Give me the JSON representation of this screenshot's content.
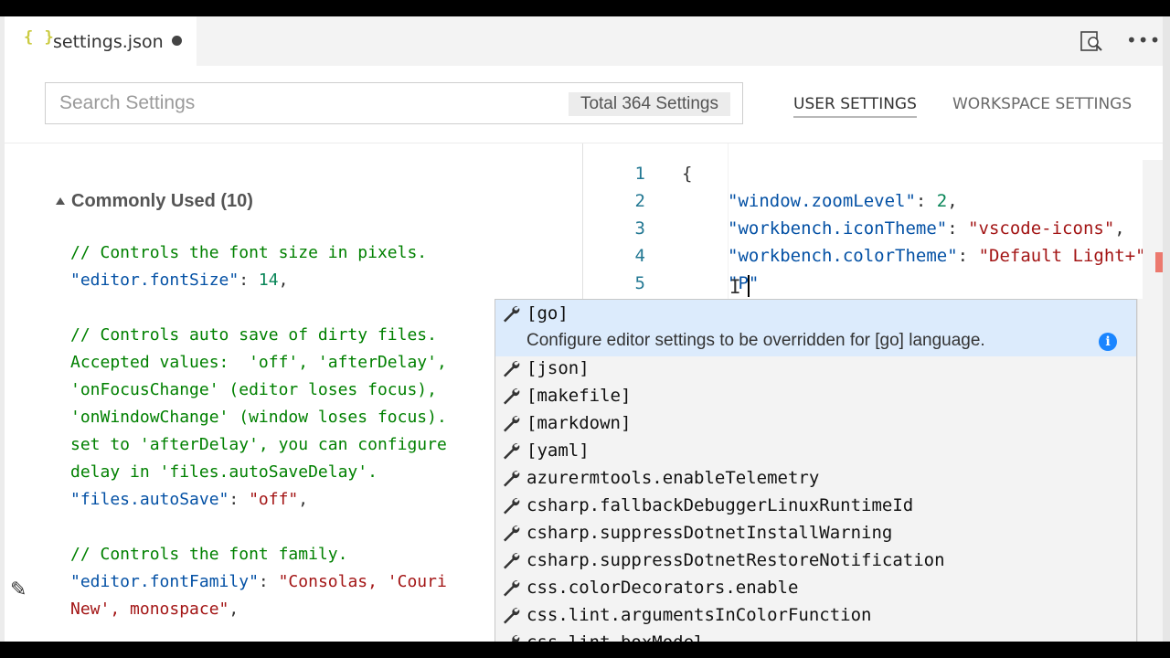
{
  "tab": {
    "icon": "{ }",
    "title": "settings.json"
  },
  "header": {
    "search_placeholder": "Search Settings",
    "count_badge": "Total 364 Settings",
    "tabs": [
      "USER SETTINGS",
      "WORKSPACE SETTINGS"
    ]
  },
  "default_pane": {
    "group_title": "Commonly Used (10)",
    "lines": [
      "// Controls the font size in pixels.",
      "\"editor.fontSize\"",
      ": ",
      "14",
      ",",
      "// Controls auto save of dirty files.",
      "Accepted values:  'off', 'afterDelay',",
      "'onFocusChange' (editor loses focus),",
      "'onWindowChange' (window loses focus).",
      "set to 'afterDelay', you can configure",
      "delay in 'files.autoSaveDelay'.",
      "\"files.autoSave\"",
      ": ",
      "\"off\"",
      ",",
      "// Controls the font family.",
      "\"editor.fontFamily\"",
      ": ",
      "\"Consolas, 'Couri",
      "New', monospace\"",
      ","
    ]
  },
  "editor": {
    "line_numbers": [
      "1",
      "2",
      "3",
      "4",
      "5"
    ],
    "code": {
      "l1": "{",
      "l2_key": "\"window.zoomLevel\"",
      "l2_colon": ": ",
      "l2_val": "2",
      "l2_end": ",",
      "l3_key": "\"workbench.iconTheme\"",
      "l3_colon": ": ",
      "l3_val": "\"vscode-icons\"",
      "l3_end": ",",
      "l4_key": "\"workbench.colorTheme\"",
      "l4_colon": ": ",
      "l4_val": "\"Default Light+\"",
      "l5_val": "\"P\""
    }
  },
  "suggest": {
    "selected_detail": "Configure editor settings to be overridden for [go] language.",
    "items": [
      "[go]",
      "[json]",
      "[makefile]",
      "[markdown]",
      "[yaml]",
      "azurermtools.enableTelemetry",
      "csharp.fallbackDebuggerLinuxRuntimeId",
      "csharp.suppressDotnetInstallWarning",
      "csharp.suppressDotnetRestoreNotification",
      "css.colorDecorators.enable",
      "css.lint.argumentsInColorFunction",
      "css.lint.boxModel"
    ],
    "item_icon": "wrench-icon",
    "detail_icon": "info-icon"
  },
  "icons": {
    "tab": "json-file-icon",
    "preview": "open-preview-icon",
    "more": "more-actions-icon",
    "collapse": "collapse-arrow-icon",
    "edit": "edit-pencil-icon"
  },
  "colors": {
    "comment": "#008000",
    "key": "#0451a5",
    "string": "#a31515",
    "number": "#098658",
    "selection": "#dcebfc",
    "line_number": "#237893",
    "info": "#1a85ff"
  }
}
